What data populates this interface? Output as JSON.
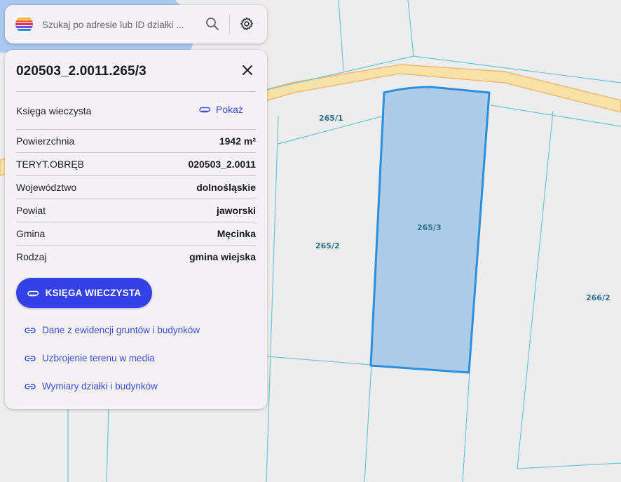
{
  "map": {
    "parcel_labels": [
      "265/1",
      "265/2",
      "265/3",
      "266/2"
    ],
    "selected_fill": "#aecbe8",
    "selected_stroke": "#2b8fe0",
    "road_color": "#f9e2a8",
    "boundary_color": "#6ec3d6"
  },
  "search": {
    "placeholder": "Szukaj po adresie lub ID działki ..."
  },
  "panel": {
    "title": "020503_2.0011.265/3",
    "kw_label": "Księga wieczysta",
    "kw_link": "Pokaż",
    "rows": [
      {
        "label": "Powierzchnia",
        "value": "1942 m²"
      },
      {
        "label": "TERYT.OBRĘB",
        "value": "020503_2.0011"
      },
      {
        "label": "Województwo",
        "value": "dolnośląskie"
      },
      {
        "label": "Powiat",
        "value": "jaworski"
      },
      {
        "label": "Gmina",
        "value": "Męcinka"
      },
      {
        "label": "Rodzaj",
        "value": "gmina wiejska"
      }
    ],
    "primary_button": "KSIĘGA WIECZYSTA",
    "links": [
      "Dane z ewidencji gruntów i budynków",
      "Uzbrojenie terenu w media",
      "Wymiary działki i budynków"
    ]
  },
  "colors": {
    "accent": "#3440e8",
    "link": "#3b4bd6",
    "panel_bg": "#f4f2f7"
  }
}
